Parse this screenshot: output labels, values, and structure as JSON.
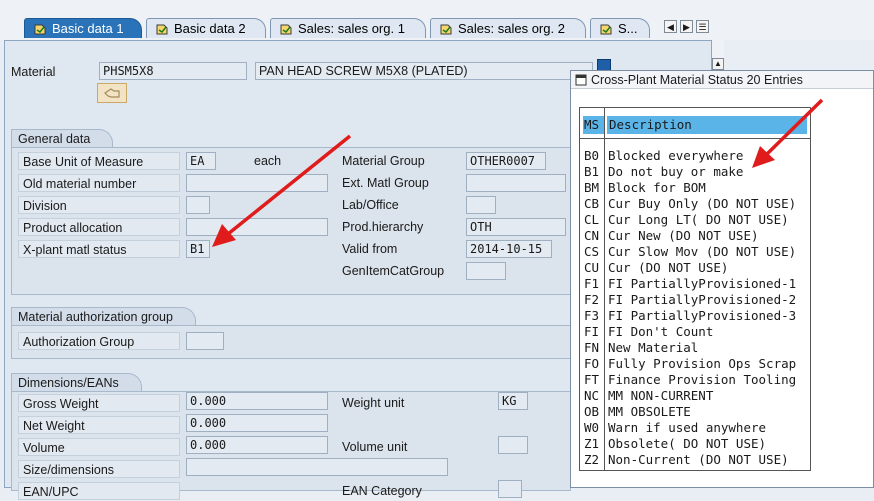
{
  "tabs": [
    {
      "label": "Basic data 1",
      "active": true
    },
    {
      "label": "Basic data 2",
      "active": false
    },
    {
      "label": "Sales: sales org. 1",
      "active": false
    },
    {
      "label": "Sales: sales org. 2",
      "active": false
    },
    {
      "label": "S...",
      "active": false
    }
  ],
  "material": {
    "label": "Material",
    "number": "PHSM5X8",
    "description": "PAN HEAD SCREW M5X8 (PLATED)"
  },
  "general_data": {
    "title": "General data",
    "base_uom_label": "Base Unit of Measure",
    "base_uom_value": "EA",
    "base_uom_text": "each",
    "old_material_label": "Old material number",
    "old_material_value": "",
    "division_label": "Division",
    "division_value": "",
    "product_allocation_label": "Product allocation",
    "product_allocation_value": "",
    "xplant_status_label": "X-plant matl status",
    "xplant_status_value": "B1",
    "material_group_label": "Material Group",
    "material_group_value": "OTHER0007",
    "ext_matl_group_label": "Ext. Matl Group",
    "ext_matl_group_value": "",
    "lab_office_label": "Lab/Office",
    "lab_office_value": "",
    "prod_hierarchy_label": "Prod.hierarchy",
    "prod_hierarchy_value": "OTH",
    "valid_from_label": "Valid from",
    "valid_from_value": "2014-10-15",
    "gen_item_cat_label": "GenItemCatGroup",
    "gen_item_cat_value": ""
  },
  "auth_group": {
    "title": "Material authorization group",
    "label": "Authorization Group",
    "value": ""
  },
  "dimensions": {
    "title": "Dimensions/EANs",
    "gross_weight_label": "Gross Weight",
    "gross_weight_value": "0.000",
    "weight_unit_label": "Weight unit",
    "weight_unit_value": "KG",
    "net_weight_label": "Net Weight",
    "net_weight_value": "0.000",
    "volume_label": "Volume",
    "volume_value": "0.000",
    "volume_unit_label": "Volume unit",
    "volume_unit_value": "",
    "size_label": "Size/dimensions",
    "size_value": "",
    "ean_label": "EAN/UPC",
    "ean_category_label": "EAN Category"
  },
  "popup": {
    "title": "Cross-Plant Material Status 20 Entries",
    "col_ms": "MS",
    "col_desc": "Description",
    "entries": [
      {
        "ms": "B0",
        "desc": "Blocked everywhere"
      },
      {
        "ms": "B1",
        "desc": "Do not buy or make"
      },
      {
        "ms": "BM",
        "desc": "Block  for  BOM"
      },
      {
        "ms": "CB",
        "desc": "Cur Buy Only (DO NOT USE)"
      },
      {
        "ms": "CL",
        "desc": "Cur Long LT( DO NOT USE)"
      },
      {
        "ms": "CN",
        "desc": "Cur New (DO NOT USE)"
      },
      {
        "ms": "CS",
        "desc": "Cur Slow Mov (DO NOT USE)"
      },
      {
        "ms": "CU",
        "desc": "Cur (DO NOT USE)"
      },
      {
        "ms": "F1",
        "desc": "FI PartiallyProvisioned-1"
      },
      {
        "ms": "F2",
        "desc": "FI PartiallyProvisioned-2"
      },
      {
        "ms": "F3",
        "desc": "FI PartiallyProvisioned-3"
      },
      {
        "ms": "FI",
        "desc": "FI Don't Count"
      },
      {
        "ms": "FN",
        "desc": "New Material"
      },
      {
        "ms": "FO",
        "desc": "Fully Provision Ops Scrap"
      },
      {
        "ms": "FT",
        "desc": "Finance Provision Tooling"
      },
      {
        "ms": "NC",
        "desc": "MM NON-CURRENT"
      },
      {
        "ms": "OB",
        "desc": "MM OBSOLETE"
      },
      {
        "ms": "W0",
        "desc": "Warn if used anywhere"
      },
      {
        "ms": "Z1",
        "desc": "Obsolete( DO NOT USE)"
      },
      {
        "ms": "Z2",
        "desc": "Non-Current (DO NOT USE)"
      }
    ]
  },
  "icons": {
    "tab_icon": "tab-page-icon",
    "display_button_icon": "hand-pointer-icon",
    "popup_icon": "window-icon",
    "scroll_left": "scroll-left-icon",
    "scroll_right": "scroll-right-icon",
    "tab_list": "tab-list-icon"
  },
  "colors": {
    "active_tab": "#2a73b8",
    "list_header": "#5bb4e8",
    "annotation_arrow": "#e01b1b"
  }
}
